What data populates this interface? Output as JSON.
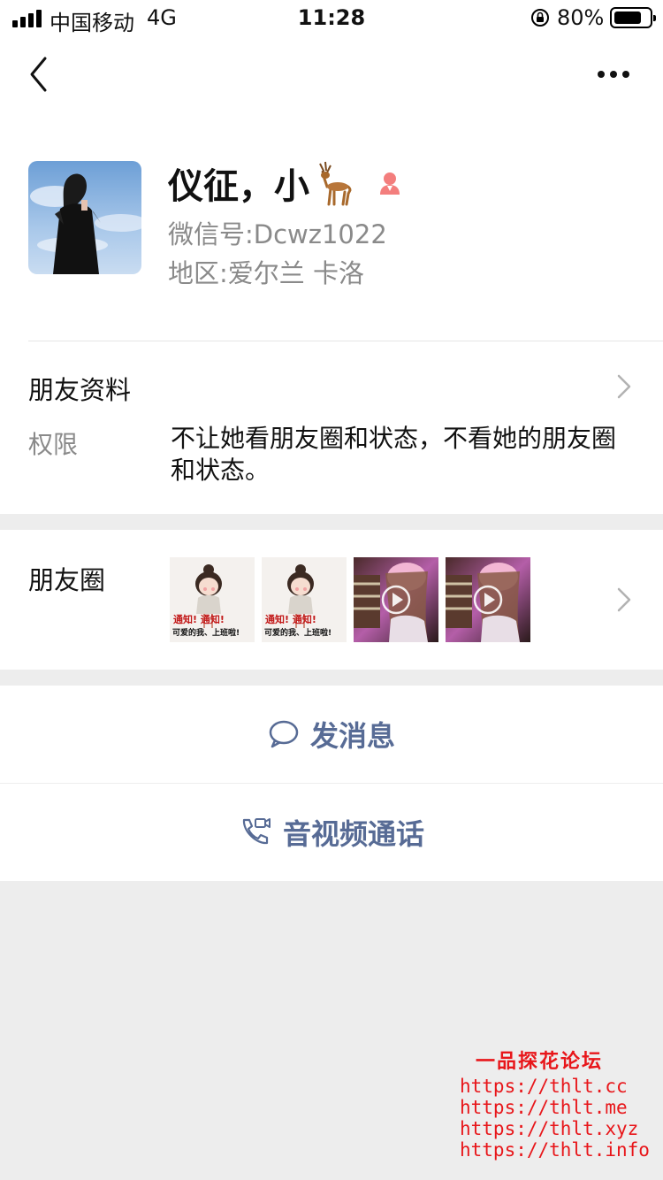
{
  "status_bar": {
    "carrier": "中国移动",
    "network": "4G",
    "time": "11:28",
    "battery_percent": "80%",
    "battery_level": 0.8
  },
  "nav": {
    "back_icon": "chevron-left-icon",
    "more_icon": "more-dots-icon"
  },
  "profile": {
    "name": "仪征，小",
    "name_emoji": "deer-emoji",
    "gender_icon": "female-icon",
    "wechat_id": "微信号:Dcwz1022",
    "region": "地区:爱尔兰 卡洛"
  },
  "friend_info": {
    "label": "朋友资料",
    "permission_label": "权限",
    "permission_text": "不让她看朋友圈和状态，不看她的朋友圈和状态。"
  },
  "moments": {
    "label": "朋友圈",
    "thumbnails": [
      {
        "type": "image",
        "caption_top": "通知! 通知!",
        "caption_bottom": "可爱的我、上班啦!"
      },
      {
        "type": "image",
        "caption_top": "通知! 通知!",
        "caption_bottom": "可爱的我、上班啦!"
      },
      {
        "type": "video"
      },
      {
        "type": "video"
      }
    ]
  },
  "actions": {
    "message": "发消息",
    "call": "音视频通话"
  },
  "watermark": {
    "title": "一品探花论坛",
    "links": [
      "https://thlt.cc",
      "https://thlt.me",
      "https://thlt.xyz",
      "https://thlt.info"
    ]
  },
  "colors": {
    "link_blue": "#576b95",
    "watermark_red": "#e8161a",
    "female_pink": "#f37e7d"
  }
}
